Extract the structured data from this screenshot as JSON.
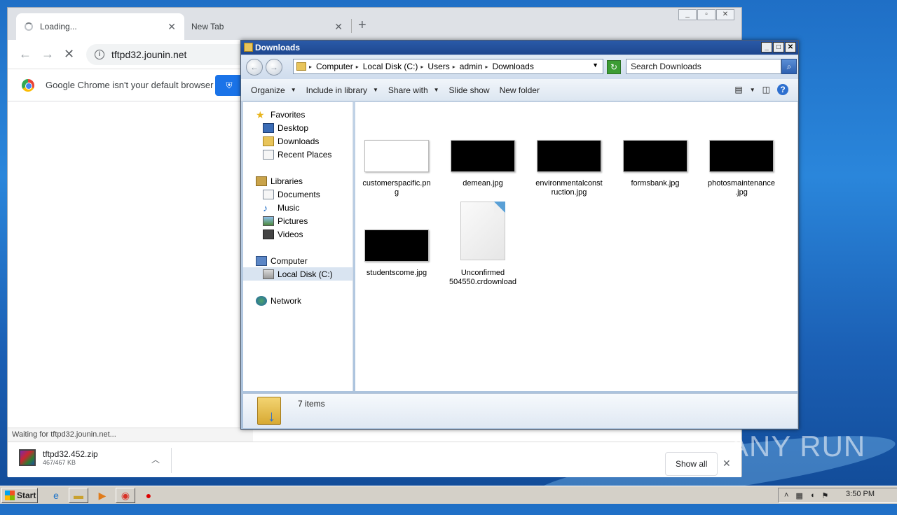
{
  "chrome": {
    "tabs": [
      {
        "label": "Loading..."
      },
      {
        "label": "New Tab"
      }
    ],
    "url": "tftpd32.jounin.net",
    "infobar_text": "Google Chrome isn't your default browser",
    "status_text": "Waiting for tftpd32.jounin.net...",
    "download": {
      "name": "tftpd32.452.zip",
      "size": "467/467 KB"
    },
    "show_all_label": "Show all"
  },
  "explorer": {
    "title": "Downloads",
    "breadcrumb": [
      "Computer",
      "Local Disk (C:)",
      "Users",
      "admin",
      "Downloads"
    ],
    "search_placeholder": "Search Downloads",
    "toolbar": {
      "organize": "Organize",
      "include": "Include in library",
      "share": "Share with",
      "slideshow": "Slide show",
      "newfolder": "New folder"
    },
    "nav": {
      "favorites": "Favorites",
      "desktop": "Desktop",
      "downloads": "Downloads",
      "recent": "Recent Places",
      "libraries": "Libraries",
      "documents": "Documents",
      "music": "Music",
      "pictures": "Pictures",
      "videos": "Videos",
      "computer": "Computer",
      "localdisk": "Local Disk (C:)",
      "network": "Network"
    },
    "files": [
      {
        "line1": "customerspacific.pn",
        "line2": "g"
      },
      {
        "line1": "demean.jpg",
        "line2": ""
      },
      {
        "line1": "environmentalconst",
        "line2": "ruction.jpg"
      },
      {
        "line1": "formsbank.jpg",
        "line2": ""
      },
      {
        "line1": "photosmaintenance",
        "line2": ".jpg"
      },
      {
        "line1": "studentscome.jpg",
        "line2": ""
      },
      {
        "line1": "Unconfirmed",
        "line2": "504550.crdownload"
      }
    ],
    "items_count": "7 items"
  },
  "taskbar": {
    "start_label": "Start",
    "clock": "3:50 PM"
  },
  "watermark": "ANY RUN"
}
